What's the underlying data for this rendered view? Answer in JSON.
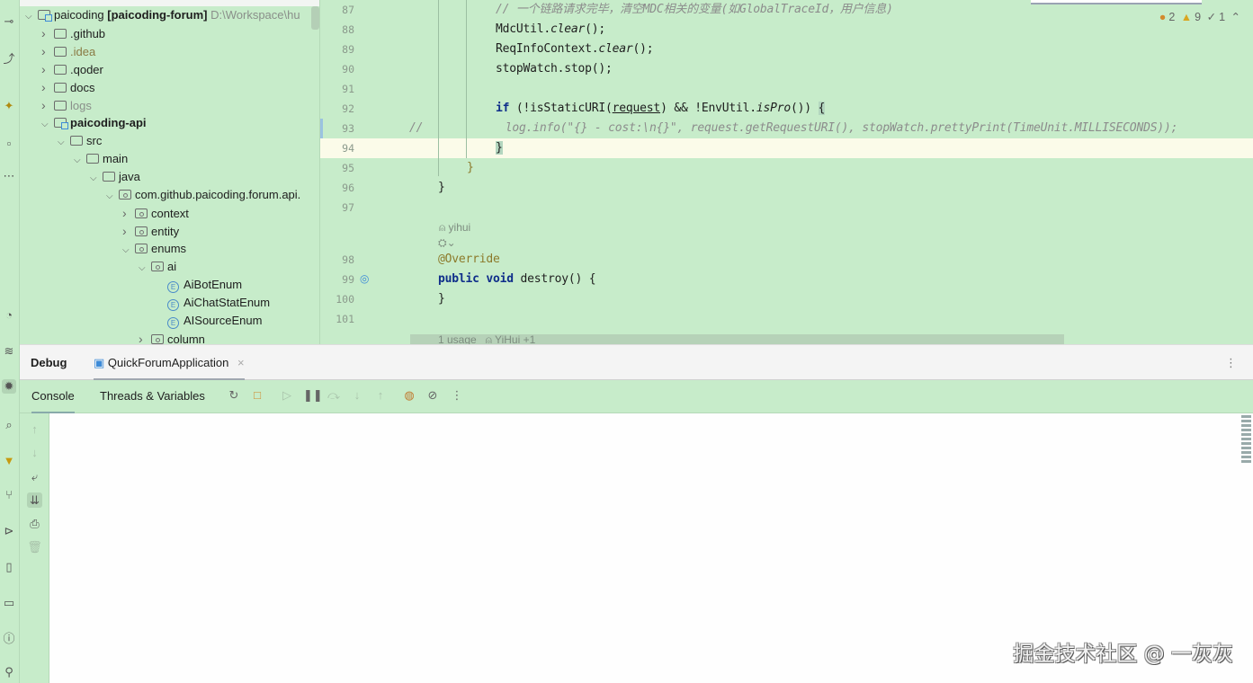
{
  "project_tree": {
    "root": {
      "name": "paicoding",
      "module": "[paicoding-forum]",
      "path": "D:\\Workspace\\hu"
    },
    "items": [
      {
        "label": ".github",
        "depth": 1,
        "expanded": false,
        "type": "folder"
      },
      {
        "label": ".idea",
        "depth": 1,
        "expanded": false,
        "type": "folder",
        "style": "idea"
      },
      {
        "label": ".qoder",
        "depth": 1,
        "expanded": false,
        "type": "folder"
      },
      {
        "label": "docs",
        "depth": 1,
        "expanded": false,
        "type": "folder"
      },
      {
        "label": "logs",
        "depth": 1,
        "expanded": false,
        "type": "folder",
        "style": "dim"
      },
      {
        "label": "paicoding-api",
        "depth": 1,
        "expanded": true,
        "type": "module",
        "style": "bold"
      },
      {
        "label": "src",
        "depth": 2,
        "expanded": true,
        "type": "folder"
      },
      {
        "label": "main",
        "depth": 3,
        "expanded": true,
        "type": "folder"
      },
      {
        "label": "java",
        "depth": 4,
        "expanded": true,
        "type": "folder"
      },
      {
        "label": "com.github.paicoding.forum.api.",
        "depth": 5,
        "expanded": true,
        "type": "package"
      },
      {
        "label": "context",
        "depth": 6,
        "expanded": false,
        "type": "package"
      },
      {
        "label": "entity",
        "depth": 6,
        "expanded": false,
        "type": "package"
      },
      {
        "label": "enums",
        "depth": 6,
        "expanded": true,
        "type": "package"
      },
      {
        "label": "ai",
        "depth": 7,
        "expanded": true,
        "type": "package"
      },
      {
        "label": "AiBotEnum",
        "depth": 8,
        "type": "enum"
      },
      {
        "label": "AiChatStatEnum",
        "depth": 8,
        "type": "enum"
      },
      {
        "label": "AISourceEnum",
        "depth": 8,
        "type": "enum"
      },
      {
        "label": "column",
        "depth": 7,
        "expanded": false,
        "type": "package"
      }
    ]
  },
  "editor": {
    "inspections": {
      "errors": "2",
      "warnings": "9",
      "typos": "1"
    },
    "lines": [
      {
        "n": "87",
        "indent": 3,
        "tokens": [
          [
            "c",
            "// 一个链路请求完毕，清空MDC相关的变量(如GlobalTraceId，用户信息)"
          ]
        ]
      },
      {
        "n": "88",
        "indent": 3,
        "tokens": [
          [
            "p",
            "MdcUtil."
          ],
          [
            "m",
            "clear"
          ],
          [
            "p",
            "();"
          ]
        ]
      },
      {
        "n": "89",
        "indent": 3,
        "tokens": [
          [
            "p",
            "ReqInfoContext."
          ],
          [
            "m",
            "clear"
          ],
          [
            "p",
            "();"
          ]
        ]
      },
      {
        "n": "90",
        "indent": 3,
        "tokens": [
          [
            "p",
            "stopWatch.stop();"
          ]
        ]
      },
      {
        "n": "91",
        "indent": 3,
        "tokens": []
      },
      {
        "n": "92",
        "indent": 3,
        "tokens": [
          [
            "k",
            "if"
          ],
          [
            "p",
            " (!isStaticURI("
          ],
          [
            "u",
            "request"
          ],
          [
            "p",
            ") && !EnvUtil."
          ],
          [
            "m",
            "isPro"
          ],
          [
            "p",
            "()) "
          ],
          [
            "hl",
            "{"
          ]
        ]
      },
      {
        "n": "93",
        "indent": 0,
        "tokens": [
          [
            "c",
            "//"
          ],
          [
            "c",
            "            log.info(\"{} - cost:\\n{}\", request.getRequestURI(), stopWatch.prettyPrint(TimeUnit.MILLISECONDS));"
          ]
        ]
      },
      {
        "n": "94",
        "indent": 3,
        "tokens": [
          [
            "hl",
            "}"
          ]
        ]
      },
      {
        "n": "95",
        "indent": 2,
        "tokens": [
          [
            "br",
            "}"
          ]
        ]
      },
      {
        "n": "96",
        "indent": 1,
        "tokens": [
          [
            "p",
            "}"
          ]
        ]
      },
      {
        "n": "97",
        "indent": 1,
        "tokens": []
      },
      {
        "n": "98",
        "indent": 1,
        "tokens": [
          [
            "an",
            "@Override"
          ]
        ]
      },
      {
        "n": "99",
        "indent": 1,
        "tokens": [
          [
            "k",
            "public void"
          ],
          [
            "p",
            " destroy() {"
          ]
        ]
      },
      {
        "n": "100",
        "indent": 1,
        "tokens": [
          [
            "p",
            "}"
          ]
        ]
      },
      {
        "n": "101",
        "indent": 1,
        "tokens": []
      }
    ],
    "author_hint": "yihui",
    "usage_hint": "1 usage",
    "usage_author": "YiHui +1"
  },
  "debug": {
    "title": "Debug",
    "run_config": "QuickForumApplication",
    "tabs": [
      "Console",
      "Threads & Variables"
    ]
  },
  "watermark": "掘金技术社区 @ 一灰灰"
}
